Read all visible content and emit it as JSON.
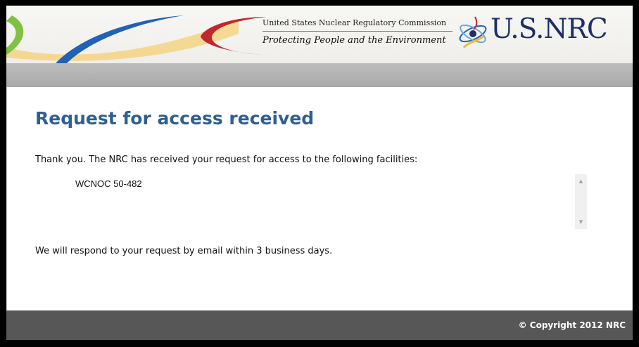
{
  "banner": {
    "agency_name": "United States Nuclear Regulatory Commission",
    "tagline": "Protecting People and the Environment",
    "logo_text": "U.S.NRC",
    "logo_icon": "atom-swirl-icon",
    "colors": {
      "green": "#7fc241",
      "blue": "#1f62b8",
      "red": "#c1272d",
      "yellow": "#f5d27c",
      "navy": "#1f2f66"
    }
  },
  "main": {
    "heading": "Request for access received",
    "intro": "Thank you. The NRC has received your request for access to the following facilities:",
    "facilities": [
      "WCNOC 50-482"
    ],
    "scroll_up_icon": "▲",
    "scroll_down_icon": "▼",
    "response_note": "We will respond to your request by email within 3 business days.",
    "heading_color": "#2e5f8f"
  },
  "footer": {
    "copyright": "© Copyright 2012 NRC"
  }
}
